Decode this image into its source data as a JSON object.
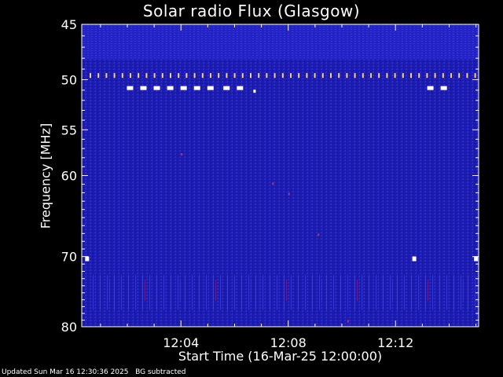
{
  "chart_data": {
    "type": "heatmap",
    "title": "Solar radio Flux (Glasgow)",
    "ylabel": "Frequency [MHz]",
    "xlabel": "Start Time (16-Mar-25 12:00:00)",
    "y_ticks": [
      45,
      50,
      55,
      60,
      70,
      80
    ],
    "ylim": [
      45,
      80
    ],
    "y_scale": "log",
    "y_inverted": true,
    "x_ticks": [
      "12:04",
      "12:08",
      "12:12"
    ],
    "x_tick_minutes": [
      4,
      8,
      12
    ],
    "xlim_minutes": [
      0.3,
      15.1
    ],
    "colormap": [
      "#1a1aa8",
      "#2a2ad4",
      "#3c3ce6",
      "#7a1a8a"
    ],
    "background": "#000000",
    "features": {
      "interference_band_mhz": 49.6,
      "bright_dots_mhz": 50.8,
      "bright_dots_minutes_group1": [
        2.1,
        2.6,
        3.1,
        3.6,
        4.1,
        4.6,
        5.1,
        5.7,
        6.2
      ],
      "bright_dots_minutes_group2": [
        13.3,
        13.8
      ],
      "bright_dots_70mhz": [
        0.5,
        12.7,
        15.0
      ],
      "noisy_band_mhz": [
        72.5,
        77.5
      ]
    },
    "grid": false
  },
  "footer": "Updated Sun Mar 16 12:30:36 2025   BG subtracted"
}
